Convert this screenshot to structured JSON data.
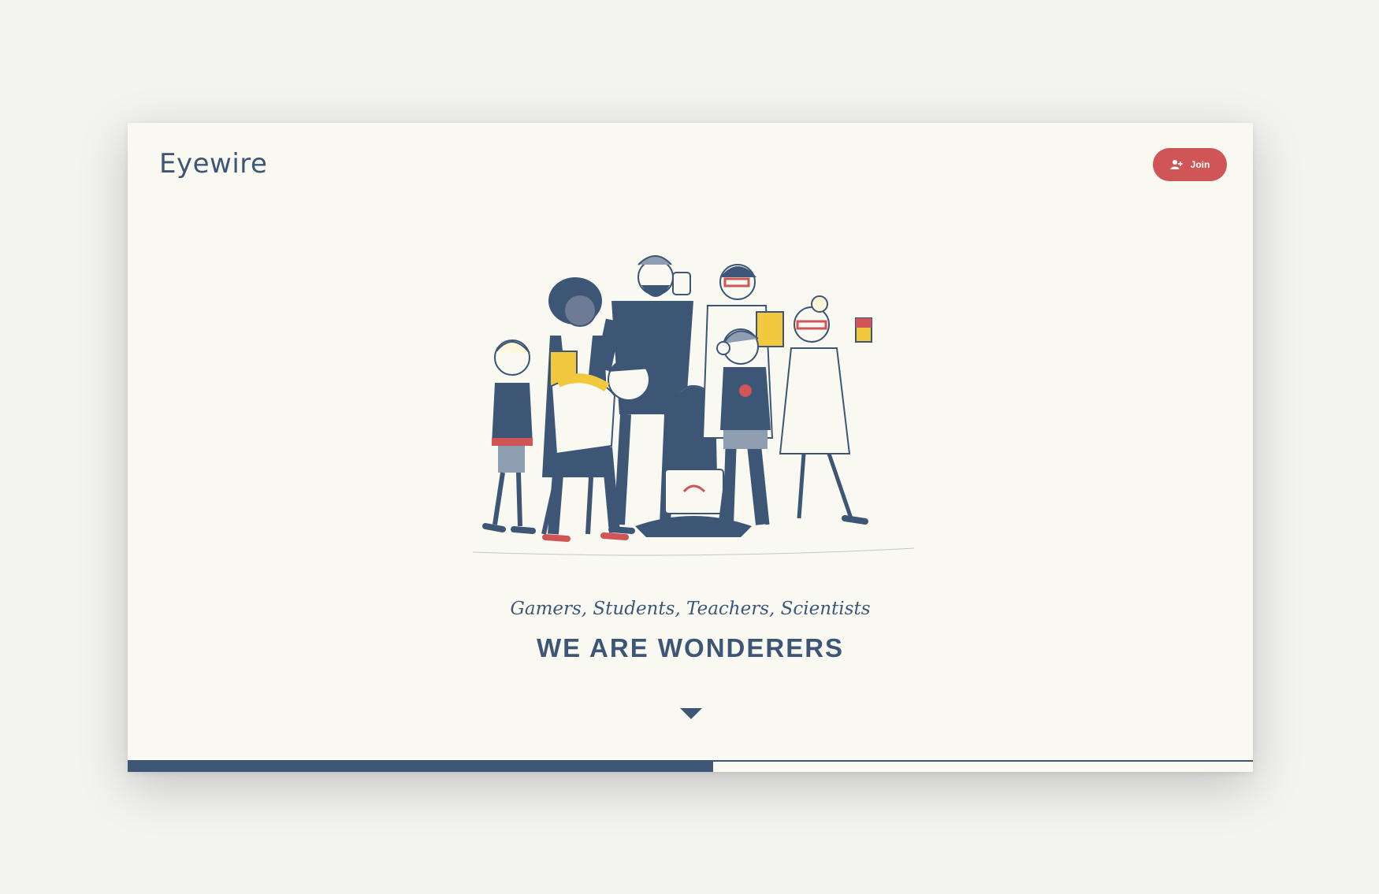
{
  "header": {
    "logo_text": "Eyewire",
    "join_label": "Join",
    "join_icon": "add-user-icon"
  },
  "hero": {
    "illustration": "group-of-people-illustration",
    "tagline": "Gamers, Students, Teachers, Scientists",
    "headline": "WE ARE WONDERERS",
    "scroll_icon": "chevron-down-icon"
  },
  "progress": {
    "value": 0.52
  },
  "colors": {
    "navy": "#3d5676",
    "accent_red": "#cf5557",
    "cream": "#faf9f1",
    "yellow": "#f2c83f"
  }
}
